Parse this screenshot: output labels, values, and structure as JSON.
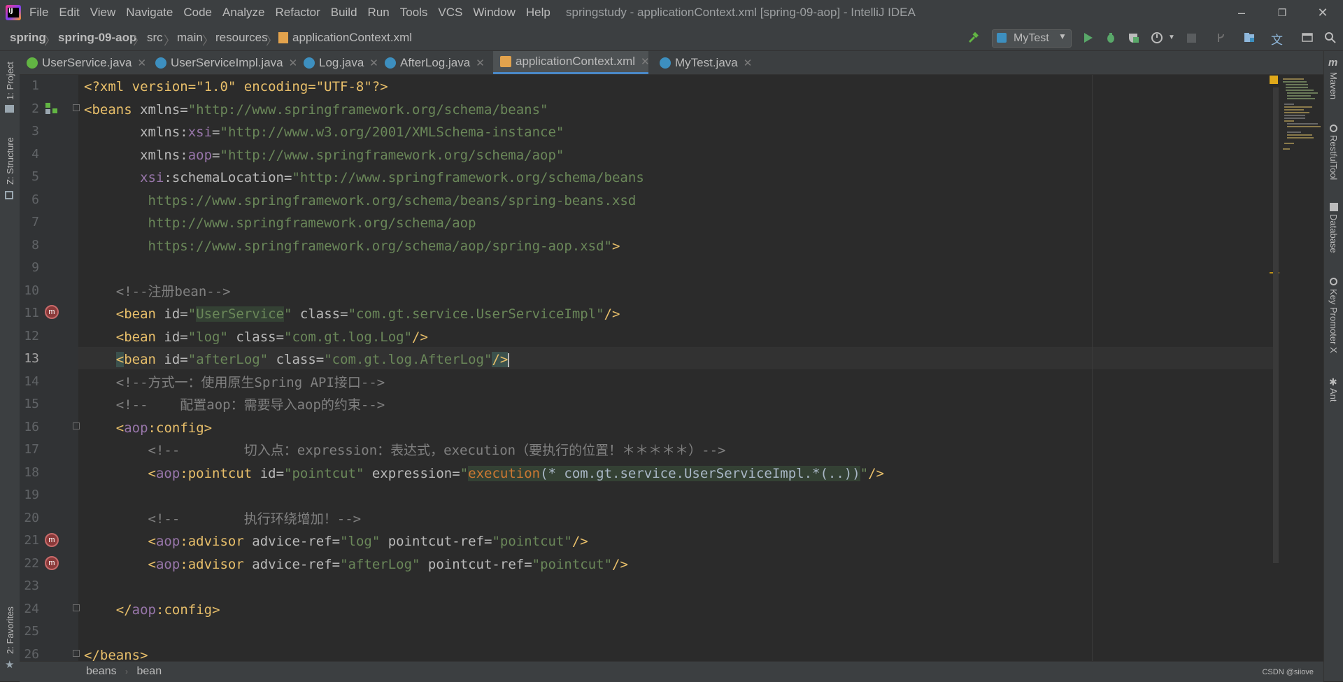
{
  "window": {
    "title": "springstudy - applicationContext.xml [spring-09-aop] - IntelliJ IDEA",
    "menu": [
      "File",
      "Edit",
      "View",
      "Navigate",
      "Code",
      "Analyze",
      "Refactor",
      "Build",
      "Run",
      "Tools",
      "VCS",
      "Window",
      "Help"
    ]
  },
  "navbar": {
    "crumbs": [
      "spring",
      "spring-09-aop",
      "src",
      "main",
      "resources",
      "applicationContext.xml"
    ],
    "run_config": "MyTest"
  },
  "tabs": [
    {
      "label": "UserService.java",
      "icon": "interface-icon",
      "color": "#62b543"
    },
    {
      "label": "UserServiceImpl.java",
      "icon": "class-icon",
      "color": "#3d8fbf"
    },
    {
      "label": "Log.java",
      "icon": "class-icon",
      "color": "#3d8fbf"
    },
    {
      "label": "AfterLog.java",
      "icon": "class-icon",
      "color": "#3d8fbf"
    },
    {
      "label": "applicationContext.xml",
      "icon": "xml-spring-icon",
      "color": "#e3a34d",
      "active": true
    },
    {
      "label": "MyTest.java",
      "icon": "class-icon",
      "color": "#3d8fbf"
    }
  ],
  "left_tools": [
    "1: Project",
    "Z: Structure",
    "2: Favorites"
  ],
  "right_tools": [
    "Maven",
    "RestfulTool",
    "Database",
    "Key Promoter X",
    "Ant"
  ],
  "lines": {
    "n1": "1",
    "n2": "2",
    "n3": "3",
    "n4": "4",
    "n5": "5",
    "n6": "6",
    "n7": "7",
    "n8": "8",
    "n9": "9",
    "n10": "10",
    "n11": "11",
    "n12": "12",
    "n13": "13",
    "n14": "14",
    "n15": "15",
    "n16": "16",
    "n17": "17",
    "n18": "18",
    "n19": "19",
    "n20": "20",
    "n21": "21",
    "n22": "22",
    "n23": "23",
    "n24": "24",
    "n25": "25",
    "n26": "26"
  },
  "code": {
    "l1": "<?xml version=\"1.0\" encoding=\"UTF-8\"?>",
    "l2_tag": "<beans ",
    "l2_attr": "xmlns",
    "l2_val": "\"http://www.springframework.org/schema/beans\"",
    "l3_ns": "xsi",
    "l3_val": "\"http://www.w3.org/2001/XMLSchema-instance\"",
    "l4_ns": "aop",
    "l4_val": "\"http://www.springframework.org/schema/aop\"",
    "l5_ns": "xsi",
    "l5_attr": ":schemaLocation=",
    "l5_val": "\"http://www.springframework.org/schema/beans",
    "l6": "https://www.springframework.org/schema/beans/spring-beans.xsd",
    "l7": "http://www.springframework.org/schema/aop",
    "l8": "https://www.springframework.org/schema/aop/spring-aop.xsd\"",
    "l10": "<!--注册bean-->",
    "l11_id": "UserService",
    "l11_class": "\"com.gt.service.UserServiceImpl\"",
    "l12_id": "\"log\"",
    "l12_class": "\"com.gt.log.Log\"",
    "l13_id": "\"afterLog\"",
    "l13_class": "\"com.gt.log.AfterLog\"",
    "l14": "<!--方式一：使用原生Spring API接口-->",
    "l15": "<!--    配置aop：需要导入aop的约束-->",
    "l16": "config",
    "l17": "<!--        切入点：expression：表达式，execution（要执行的位置！＊＊＊＊＊）-->",
    "l18_id": "\"pointcut\"",
    "l18_expr_kw": "execution",
    "l18_expr": "(* com.gt.service.UserServiceImpl.*(..))",
    "l20": "<!--        执行环绕增加！-->",
    "l21_ref": "\"log\"",
    "l21_pc": "\"pointcut\"",
    "l22_ref": "\"afterLog\"",
    "l22_pc": "\"pointcut\"",
    "l24": "config",
    "l26": "</beans>"
  },
  "status": {
    "breadcrumbs": [
      "beans",
      "bean"
    ],
    "watermark": "CSDN @siiove"
  }
}
